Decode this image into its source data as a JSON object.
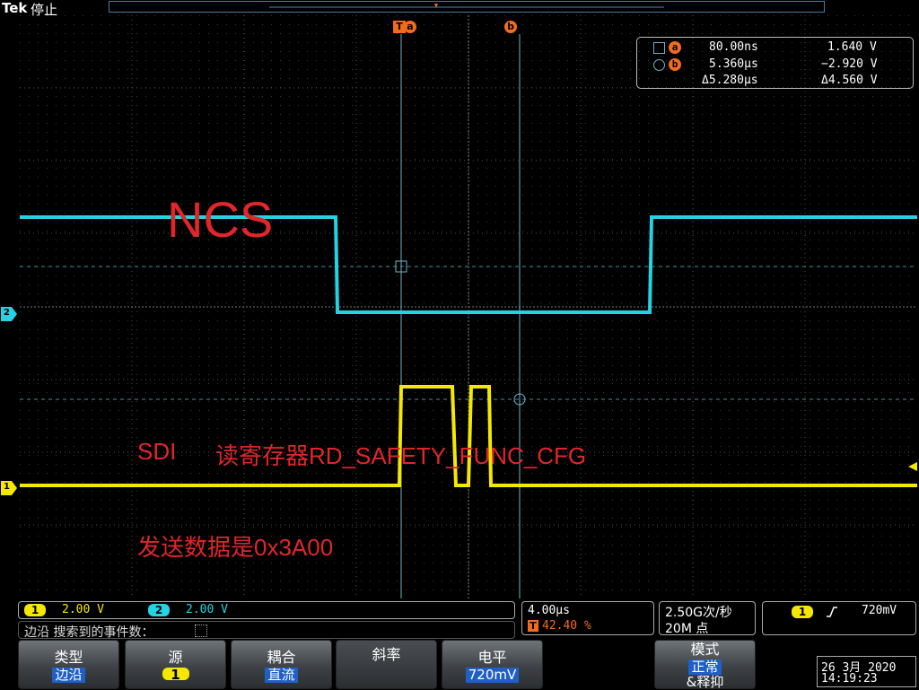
{
  "header": {
    "brand": "Tek",
    "status": "停止"
  },
  "cursors": {
    "a_label": "a",
    "b_label": "b",
    "trigger_label": "T"
  },
  "readout": {
    "a_time": "80.00ns",
    "a_volt": "1.640 V",
    "b_time": "5.360µs",
    "b_volt": "−2.920 V",
    "delta_time": "Δ5.280µs",
    "delta_volt": "Δ4.560 V"
  },
  "annotations": {
    "ncs": "NCS",
    "sdi": "SDI",
    "register": "读寄存器RD_SAFETY_FUNC_CFG",
    "send": "发送数据是0x3A00"
  },
  "channels": [
    {
      "label": "1",
      "scale": "2.00 V",
      "color": "#f5e800"
    },
    {
      "label": "2",
      "scale": "2.00 V",
      "color": "#22d3e3"
    }
  ],
  "search": {
    "text": "边沿 搜索到的事件数："
  },
  "timebase": {
    "per_div": "4.00µs",
    "trigger_pos_label": "T",
    "trigger_pos": "42.40 %"
  },
  "acquisition": {
    "rate": "2.50G次/秒",
    "record": "20M 点"
  },
  "trigger": {
    "source": "1",
    "slope_icon": "rising-edge",
    "level": "720mV"
  },
  "menu": {
    "type_label": "类型",
    "type_value": "边沿",
    "source_label": "源",
    "source_value": "1",
    "coupling_label": "耦合",
    "coupling_value": "直流",
    "slope_label": "斜率",
    "level_label": "电平",
    "level_value": "720mV",
    "mode_label": "模式",
    "mode_value": "正常",
    "mode_extra": "&释抑"
  },
  "datetime": {
    "date": "26 3月 2020",
    "time": "14:19:23"
  }
}
